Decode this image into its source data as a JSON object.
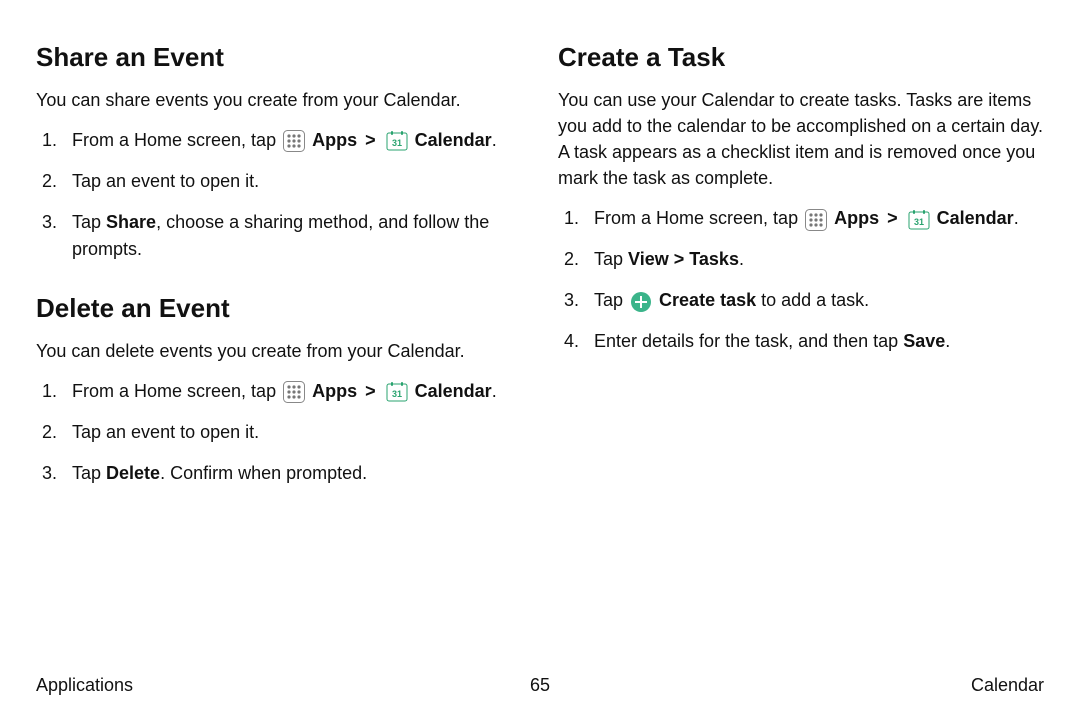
{
  "left": {
    "section1": {
      "heading": "Share an Event",
      "intro": "You can share events you create from your Calendar.",
      "steps": {
        "s1a": "From a Home screen, tap ",
        "apps": "Apps",
        "cal": "Calendar",
        "s1end": ".",
        "s2": "Tap an event to open it.",
        "s3a": "Tap ",
        "s3b": "Share",
        "s3c": ", choose a sharing method, and follow the prompts."
      }
    },
    "section2": {
      "heading": "Delete an Event",
      "intro": "You can delete events you create from your Calendar.",
      "steps": {
        "s1a": "From a Home screen, tap ",
        "apps": "Apps",
        "cal": "Calendar",
        "s1end": ".",
        "s2": "Tap an event to open it.",
        "s3a": "Tap ",
        "s3b": "Delete",
        "s3c": ". Confirm when prompted."
      }
    }
  },
  "right": {
    "section1": {
      "heading": "Create a Task",
      "intro": "You can use your Calendar to create tasks. Tasks are items you add to the calendar to be accomplished on a certain day. A task appears as a checklist item and is removed once you mark the task as complete.",
      "steps": {
        "s1a": "From a Home screen, tap ",
        "apps": "Apps",
        "cal": "Calendar",
        "s1end": ".",
        "s2a": "Tap ",
        "s2b": "View",
        "s2chev": " > ",
        "s2c": "Tasks",
        "s2d": ".",
        "s3a": "Tap ",
        "s3b": "Create task",
        "s3c": " to add a task.",
        "s4a": "Enter details for the task, and then tap ",
        "s4b": "Save",
        "s4c": "."
      }
    }
  },
  "footer": {
    "left": "Applications",
    "center": "65",
    "right": "Calendar"
  },
  "icons": {
    "chevron": ">"
  }
}
